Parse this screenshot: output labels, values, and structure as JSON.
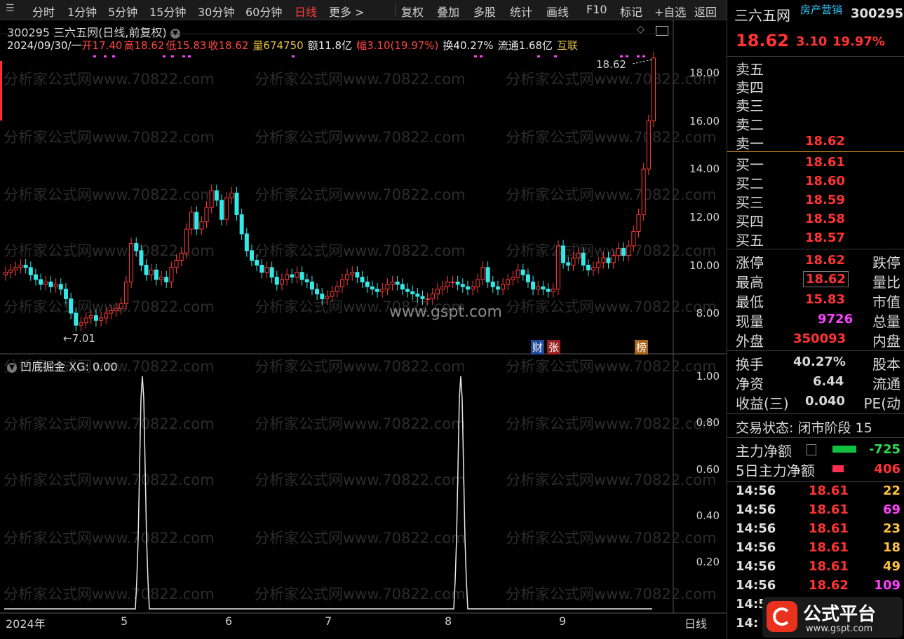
{
  "toolbar": {
    "items": [
      "分时",
      "1分钟",
      "5分钟",
      "15分钟",
      "30分钟",
      "60分钟",
      "日线",
      "更多 >"
    ],
    "right_items": [
      "复权",
      "叠加",
      "多股",
      "统计",
      "画线",
      "F10",
      "标记",
      "+自选",
      "返回"
    ]
  },
  "chart_header": {
    "title": "300295 三六五网(日线,前复权)",
    "date": "2024/09/30/一",
    "open_label": "开",
    "open": "17.40",
    "high_label": "高",
    "high": "18.62",
    "low_label": "低",
    "low": "15.83",
    "close_label": "收",
    "close": "18.62",
    "vol_label": "量",
    "vol": "674750",
    "amount_label": "额",
    "amount": "11.8亿",
    "chg_label": "幅",
    "chg": "3.10(19.97%)",
    "turnover": "换40.27%",
    "float": "流通1.68亿",
    "concept": "互联"
  },
  "price_axis": [
    "18.00",
    "16.00",
    "14.00",
    "12.00",
    "10.00",
    "8.00"
  ],
  "last_price_label": "18.62",
  "min_price_label": "←7.01",
  "badges": [
    "财",
    "张",
    "榜"
  ],
  "watermark": "分析家公式网www.70822.com",
  "site_mark": "www.gspt.com",
  "indicator": {
    "name": "凹底掘金",
    "value_text": "XG: 0.00",
    "axis": [
      "1.00",
      "0.80",
      "0.60",
      "0.40",
      "0.20"
    ]
  },
  "x_axis": [
    "2024年",
    "5",
    "6",
    "7",
    "8",
    "9"
  ],
  "x_axis_right": "日线",
  "chart_data": {
    "type": "candlestick",
    "period": "2024 daily",
    "ylim": [
      6.5,
      19.0
    ],
    "indicator_series": {
      "name": "XG",
      "peaks_at": [
        "5月末",
        "8月中"
      ],
      "ylim": [
        0,
        1.0
      ]
    }
  },
  "quote": {
    "name": "三六五网",
    "tag": "房产营销",
    "code": "300295",
    "price": "18.62",
    "change": "3.10",
    "pct": "19.97%",
    "sell": [
      {
        "label": "卖五",
        "price": ""
      },
      {
        "label": "卖四",
        "price": ""
      },
      {
        "label": "卖三",
        "price": ""
      },
      {
        "label": "卖二",
        "price": ""
      },
      {
        "label": "卖一",
        "price": "18.62"
      }
    ],
    "buy": [
      {
        "label": "买一",
        "price": "18.61"
      },
      {
        "label": "买二",
        "price": "18.60"
      },
      {
        "label": "买三",
        "price": "18.59"
      },
      {
        "label": "买四",
        "price": "18.58"
      },
      {
        "label": "买五",
        "price": "18.57"
      }
    ],
    "stats": [
      {
        "l": "涨停",
        "v": "18.62",
        "r": "跌停"
      },
      {
        "l": "最高",
        "v": "18.62",
        "r": "量比"
      },
      {
        "l": "最低",
        "v": "15.83",
        "r": "市值"
      },
      {
        "l": "现量",
        "v": "9726",
        "r": "总量"
      },
      {
        "l": "外盘",
        "v": "350093",
        "r": "内盘"
      }
    ],
    "stats2": [
      {
        "l": "换手",
        "v": "40.27%",
        "r": "股本"
      },
      {
        "l": "净资",
        "v": "6.44",
        "r": "流通"
      },
      {
        "l": "收益(三)",
        "v": "0.040",
        "r": "PE(动"
      }
    ],
    "trade_state": "交易状态: 闭市阶段 15",
    "main_net": {
      "label": "主力净额",
      "value": "-725"
    },
    "main_net5": {
      "label": "5日主力净额",
      "value": "406"
    },
    "ticks": [
      {
        "t": "14:56",
        "p": "18.61",
        "v": "22"
      },
      {
        "t": "14:56",
        "p": "18.61",
        "v": "69"
      },
      {
        "t": "14:56",
        "p": "18.61",
        "v": "23"
      },
      {
        "t": "14:56",
        "p": "18.61",
        "v": "18"
      },
      {
        "t": "14:56",
        "p": "18.61",
        "v": "49"
      },
      {
        "t": "14:56",
        "p": "18.62",
        "v": "109"
      },
      {
        "t": "14:5",
        "p": "",
        "v": ""
      },
      {
        "t": "14:",
        "p": "",
        "v": ""
      }
    ]
  },
  "logo_text": "公式平台",
  "logo_url": "www.gspt.com"
}
